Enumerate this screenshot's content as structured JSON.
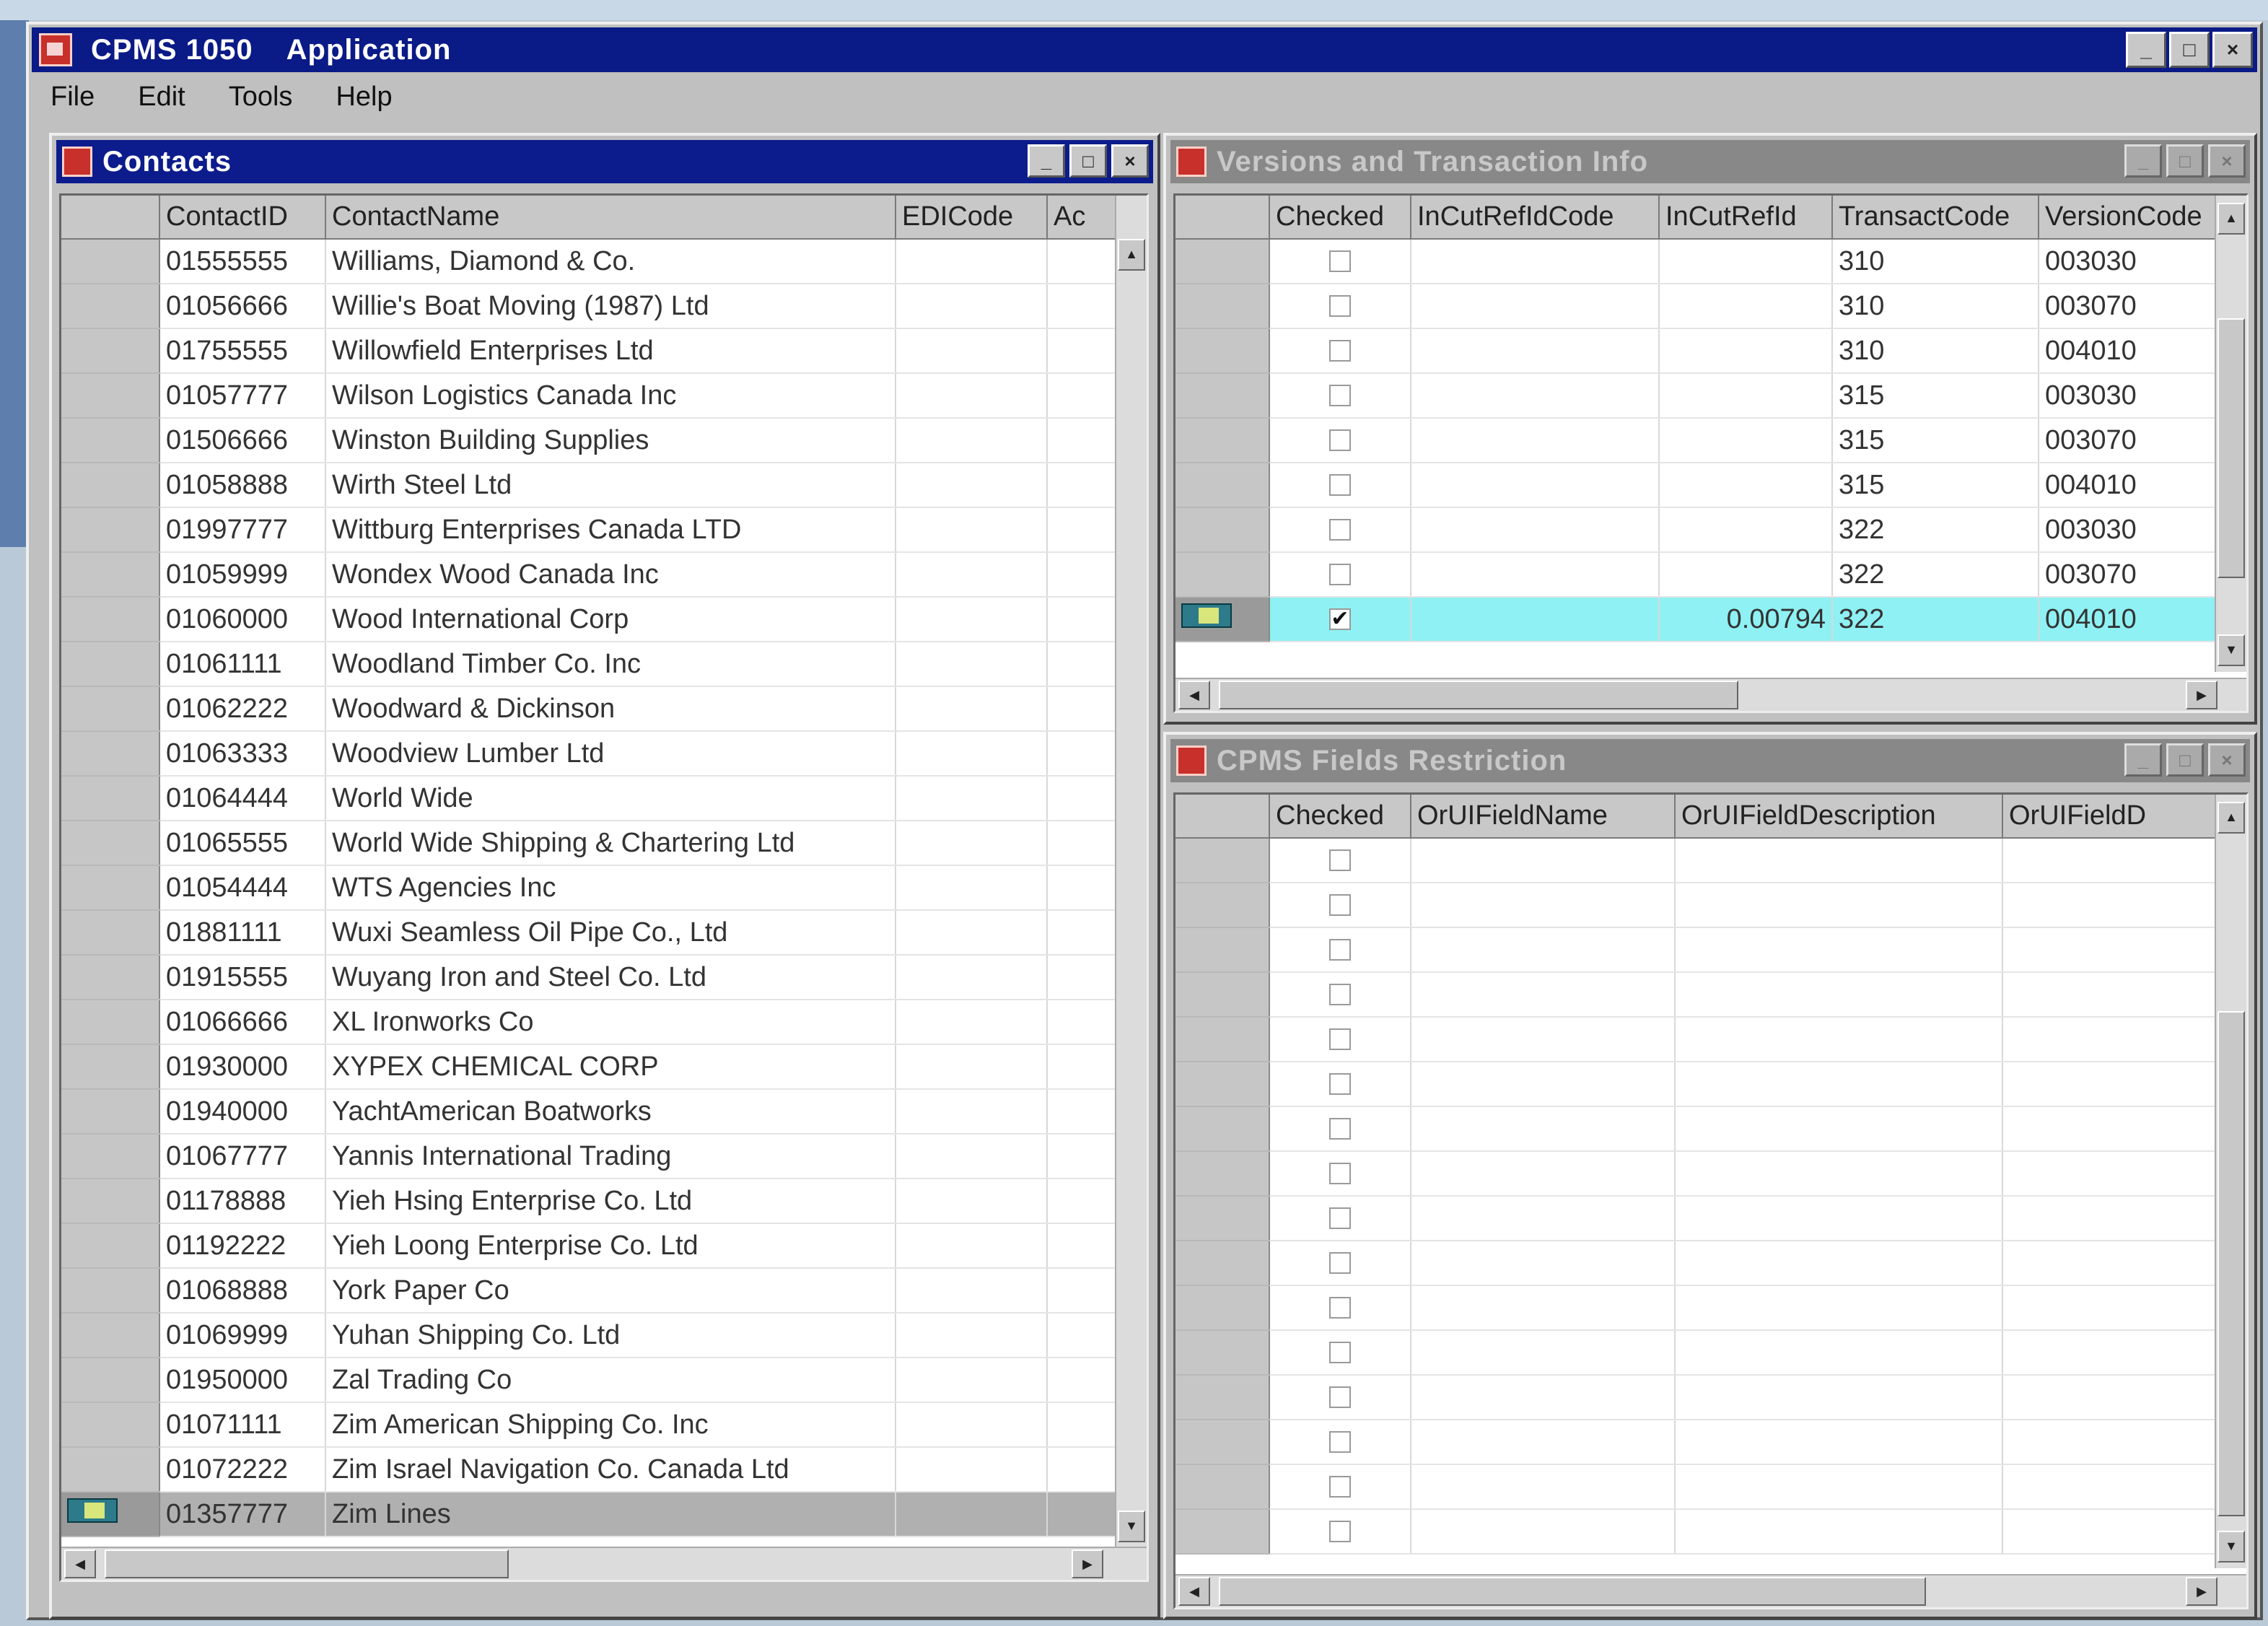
{
  "app": {
    "title_code": "CPMS 1050",
    "title_text": "Application",
    "menu": [
      "File",
      "Edit",
      "Tools",
      "Help"
    ]
  },
  "contacts": {
    "title": "Contacts",
    "columns": [
      "ContactID",
      "ContactName",
      "EDICode",
      "Ac"
    ],
    "rows": [
      {
        "id": "01555555",
        "name": "Williams, Diamond & Co."
      },
      {
        "id": "01056666",
        "name": "Willie's Boat Moving (1987) Ltd"
      },
      {
        "id": "01755555",
        "name": "Willowfield Enterprises Ltd"
      },
      {
        "id": "01057777",
        "name": "Wilson Logistics Canada Inc"
      },
      {
        "id": "01506666",
        "name": "Winston Building Supplies"
      },
      {
        "id": "01058888",
        "name": "Wirth Steel Ltd"
      },
      {
        "id": "01997777",
        "name": "Wittburg Enterprises Canada LTD"
      },
      {
        "id": "01059999",
        "name": "Wondex Wood Canada Inc"
      },
      {
        "id": "01060000",
        "name": "Wood International Corp"
      },
      {
        "id": "01061111",
        "name": "Woodland Timber Co. Inc"
      },
      {
        "id": "01062222",
        "name": "Woodward & Dickinson"
      },
      {
        "id": "01063333",
        "name": "Woodview Lumber Ltd"
      },
      {
        "id": "01064444",
        "name": "World Wide"
      },
      {
        "id": "01065555",
        "name": "World Wide Shipping & Chartering Ltd"
      },
      {
        "id": "01054444",
        "name": "WTS Agencies Inc"
      },
      {
        "id": "01881111",
        "name": "Wuxi Seamless Oil Pipe Co., Ltd"
      },
      {
        "id": "01915555",
        "name": "Wuyang Iron and Steel Co. Ltd"
      },
      {
        "id": "01066666",
        "name": "XL Ironworks Co"
      },
      {
        "id": "01930000",
        "name": "XYPEX CHEMICAL CORP"
      },
      {
        "id": "01940000",
        "name": "YachtAmerican Boatworks"
      },
      {
        "id": "01067777",
        "name": "Yannis International Trading"
      },
      {
        "id": "01178888",
        "name": "Yieh Hsing Enterprise Co. Ltd"
      },
      {
        "id": "01192222",
        "name": "Yieh Loong Enterprise Co. Ltd"
      },
      {
        "id": "01068888",
        "name": "York Paper Co"
      },
      {
        "id": "01069999",
        "name": "Yuhan Shipping Co. Ltd"
      },
      {
        "id": "01950000",
        "name": "Zal Trading Co"
      },
      {
        "id": "01071111",
        "name": "Zim American Shipping Co. Inc"
      },
      {
        "id": "01072222",
        "name": "Zim Israel Navigation Co. Canada Ltd"
      },
      {
        "id": "01357777",
        "name": "Zim Lines"
      }
    ]
  },
  "versions": {
    "title": "Versions and Transaction Info",
    "columns": [
      "Checked",
      "InCutRefIdCode",
      "InCutRefId",
      "TransactCode",
      "VersionCode"
    ],
    "rows": [
      {
        "checked": "",
        "ref_code": "",
        "ref_id": "",
        "transact": "310",
        "version": "003030"
      },
      {
        "checked": "",
        "ref_code": "",
        "ref_id": "",
        "transact": "310",
        "version": "003070"
      },
      {
        "checked": "",
        "ref_code": "",
        "ref_id": "",
        "transact": "310",
        "version": "004010"
      },
      {
        "checked": "",
        "ref_code": "",
        "ref_id": "",
        "transact": "315",
        "version": "003030"
      },
      {
        "checked": "",
        "ref_code": "",
        "ref_id": "",
        "transact": "315",
        "version": "003070"
      },
      {
        "checked": "",
        "ref_code": "",
        "ref_id": "",
        "transact": "315",
        "version": "004010"
      },
      {
        "checked": "",
        "ref_code": "",
        "ref_id": "",
        "transact": "322",
        "version": "003030"
      },
      {
        "checked": "",
        "ref_code": "",
        "ref_id": "",
        "transact": "322",
        "version": "003070"
      },
      {
        "checked": "✔",
        "ref_code": "",
        "ref_id": "0.00794",
        "transact": "322",
        "version": "004010"
      }
    ]
  },
  "fields": {
    "title": "CPMS Fields Restriction",
    "columns": [
      "Checked",
      "OrUIFieldName",
      "OrUIFieldDescription",
      "OrUIFieldD"
    ],
    "row_count": 16
  }
}
